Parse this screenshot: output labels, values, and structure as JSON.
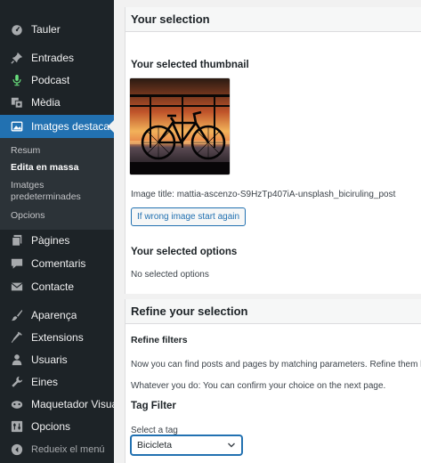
{
  "sidebar": {
    "items": [
      {
        "label": "Tauler",
        "icon": "dashboard-icon"
      },
      {
        "label": "Entrades",
        "icon": "pin-icon"
      },
      {
        "label": "Podcast",
        "icon": "microphone-icon"
      },
      {
        "label": "Mèdia",
        "icon": "media-icon"
      },
      {
        "label": "Imatges destacades",
        "icon": "images-icon"
      },
      {
        "label": "Pàgines",
        "icon": "pages-icon"
      },
      {
        "label": "Comentaris",
        "icon": "comment-icon"
      },
      {
        "label": "Contacte",
        "icon": "mail-icon"
      },
      {
        "label": "Aparença",
        "icon": "brush-icon"
      },
      {
        "label": "Extensions",
        "icon": "plugin-icon"
      },
      {
        "label": "Usuaris",
        "icon": "users-icon"
      },
      {
        "label": "Eines",
        "icon": "wrench-icon"
      },
      {
        "label": "Maquetador Visual",
        "icon": "builder-icon"
      },
      {
        "label": "Opcions",
        "icon": "settings-icon"
      }
    ],
    "submenu": {
      "resum": "Resum",
      "edita": "Edita en massa",
      "imatges_line1": "Imatges",
      "imatges_line2": "predeterminades",
      "opcions": "Opcions"
    },
    "collapse": "Redueix el menú"
  },
  "main": {
    "selection_header": "Your selection",
    "thumbnail_heading": "Your selected thumbnail",
    "image_title_label": "Image title:",
    "image_title_value": "mattia-ascenzo-S9HzTp407iA-unsplash_biciruling_post",
    "restart_button": "If wrong image start again",
    "options_heading": "Your selected options",
    "no_options": "No selected options",
    "refine_header": "Refine your selection",
    "refine_filters": "Refine filters",
    "refine_desc": "Now you can find posts and pages by matching parameters. Refine them here",
    "confirm_desc": "Whatever you do: You can confirm your choice on the next page.",
    "tag_filter_heading": "Tag Filter",
    "select_tag_label": "Select a tag",
    "select_tag_value": "Bicicleta"
  },
  "colors": {
    "sidebar_bg": "#1d2327",
    "submenu_bg": "#2c3338",
    "accent": "#2271b1"
  }
}
